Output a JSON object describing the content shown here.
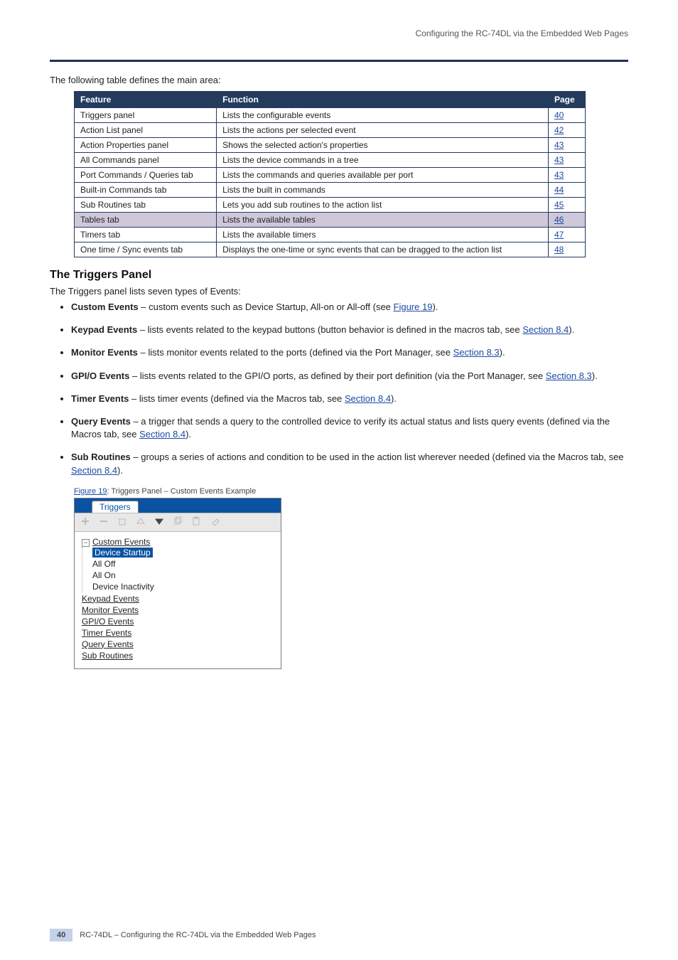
{
  "header": {
    "right": "Configuring the RC-74DL via the Embedded Web Pages"
  },
  "intro": "The following table defines the main area:",
  "table": {
    "headers": [
      "Feature",
      "Function",
      "Page"
    ],
    "rows": [
      {
        "feature": "Triggers panel",
        "func": "Lists the configurable events",
        "page": "40",
        "hl": false
      },
      {
        "feature": "Action List panel",
        "func": "Lists the actions per selected event",
        "page": "42",
        "hl": false
      },
      {
        "feature": "Action Properties panel",
        "func": "Shows the selected action's properties",
        "page": "43",
        "hl": false
      },
      {
        "feature": "All Commands panel",
        "func": "Lists the device commands in a tree",
        "page": "43",
        "hl": false
      },
      {
        "feature": "Port Commands / Queries tab",
        "func": "Lists the commands and queries available per port",
        "page": "43",
        "hl": false
      },
      {
        "feature": "Built-in Commands tab",
        "func": "Lists the built in commands",
        "page": "44",
        "hl": false
      },
      {
        "feature": "Sub Routines tab",
        "func": "Lets you add sub routines to the action list",
        "page": "45",
        "hl": false
      },
      {
        "feature": "Tables tab",
        "func": "Lists the available tables",
        "page": "46",
        "hl": true
      },
      {
        "feature": "Timers tab",
        "func": "Lists the available timers",
        "page": "47",
        "hl": false
      },
      {
        "feature": "One time / Sync events tab",
        "func": "Displays the one-time or sync events that can be dragged to the action list",
        "page": "48",
        "hl": false
      }
    ]
  },
  "section": {
    "title": "The Triggers Panel"
  },
  "triggers_intro": "The Triggers panel lists seven types of Events:",
  "triggers": [
    {
      "lead": "Custom Events",
      "dash": "–",
      "text": " custom events such as Device Startup, All-on or All-off (see ",
      "link": "Figure 19",
      "text2": ")."
    },
    {
      "lead": "Keypad Events",
      "dash": "–",
      "text": " lists events related to the keypad buttons (button behavior is defined in the macros tab, see ",
      "link": "Section 8.4",
      "text2": ")."
    },
    {
      "lead": "Monitor Events",
      "dash": "–",
      "text": " lists monitor events related to the ports (defined via the Port Manager, see ",
      "link": "Section 8.3",
      "text2": ")."
    },
    {
      "lead": "GPI/O Events",
      "dash": "–",
      "text": " lists events related to the GPI/O ports, as defined by their port definition (via the Port Manager, see ",
      "link": "Section 8.3",
      "text2": ")."
    },
    {
      "lead": "Timer Events",
      "dash": "–",
      "text": " lists timer events (defined via the Macros tab, see ",
      "link": "Section 8.4",
      "text2": ")."
    },
    {
      "lead": "Query Events",
      "dash": "–",
      "text": " a trigger that sends a query to the controlled device to verify its actual status and lists query events (defined via the Macros tab, see ",
      "link": "Section 8.4",
      "text2": ")."
    },
    {
      "lead": "Sub Routines",
      "dash": "–",
      "text": " groups a series of actions and condition to be used in the action list wherever needed (defined via the Macros tab, see ",
      "link": "Section 8.4",
      "text2": ")."
    }
  ],
  "figure": {
    "caption_link": "Figure 19",
    "caption_tail": ": Triggers Panel – Custom Events Example",
    "tab": "Triggers",
    "toolbar_icons": [
      "plus",
      "minus",
      "trash",
      "up",
      "down",
      "copy",
      "clipboard",
      "erase"
    ],
    "tree": {
      "root": "Custom Events",
      "children": [
        "Device Startup",
        "All Off",
        "All On",
        "Device Inactivity"
      ],
      "siblings": [
        "Keypad Events",
        "Monitor Events",
        "GPI/O Events",
        "Timer Events",
        "Query Events",
        "Sub Routines"
      ]
    }
  },
  "footer": {
    "page": "40",
    "doc": "RC-74DL – Configuring the RC-74DL via the Embedded Web Pages"
  },
  "glyphs": {
    "dash": "–",
    "bullet": "•"
  }
}
